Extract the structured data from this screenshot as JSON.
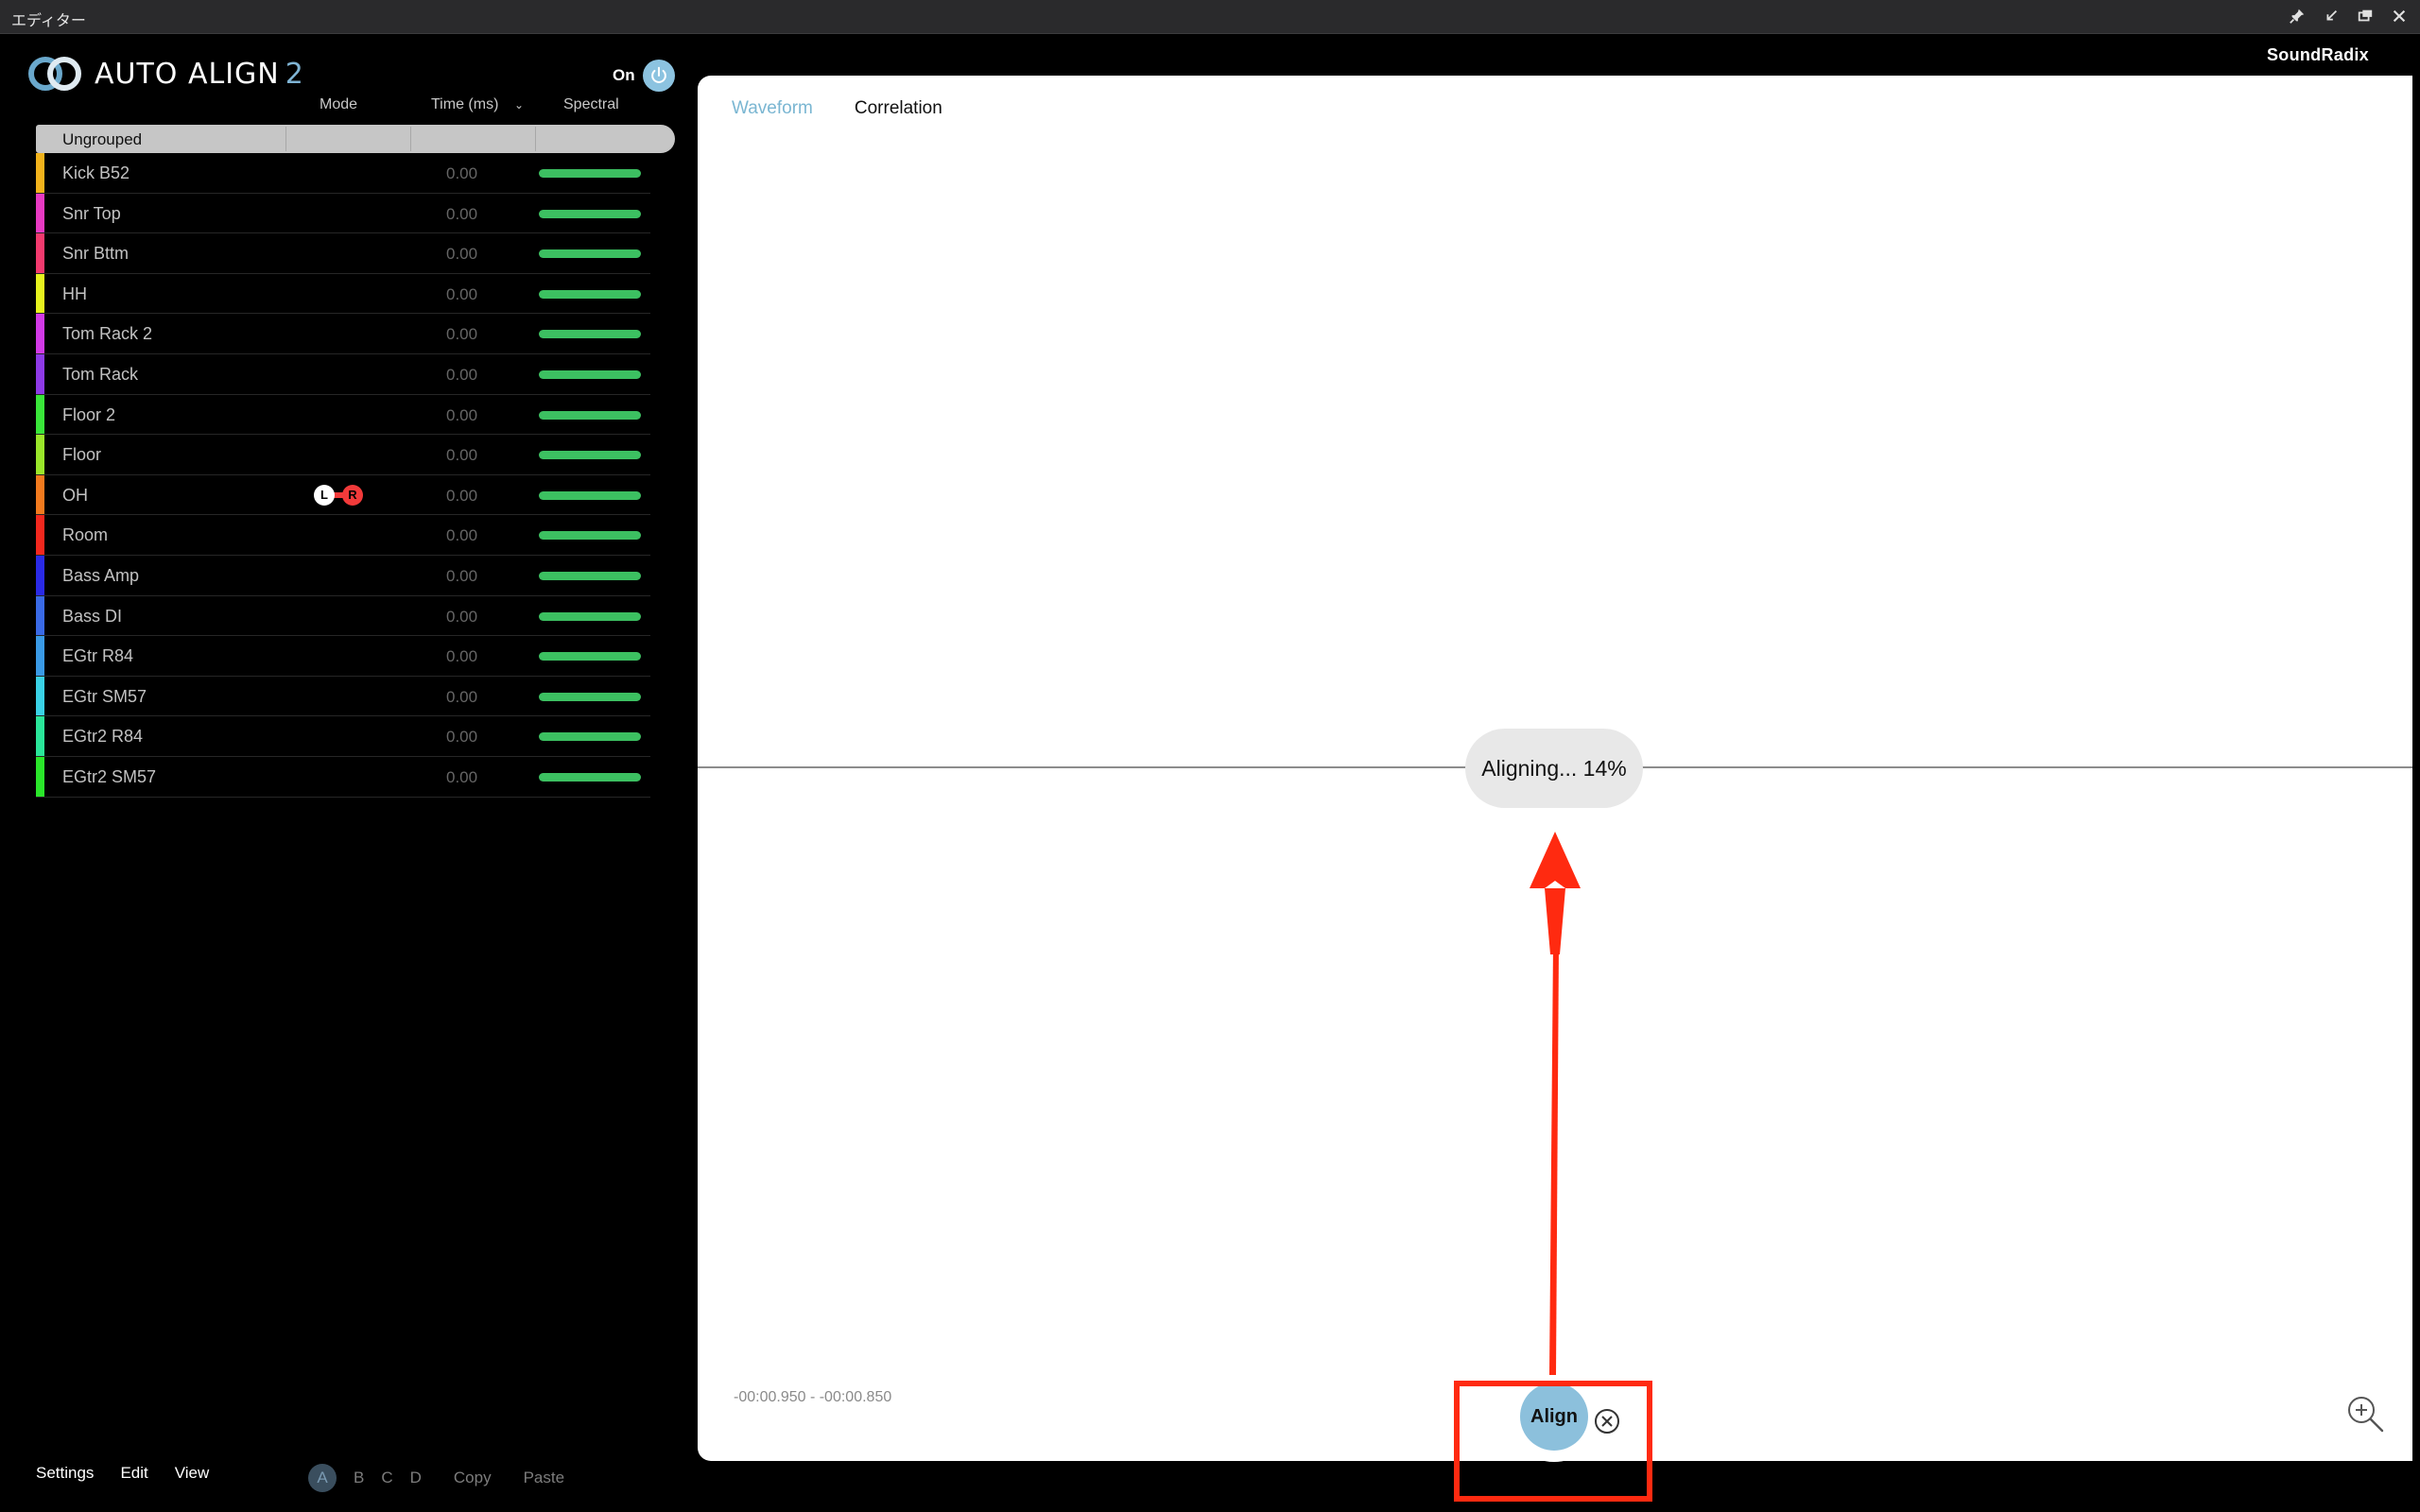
{
  "window": {
    "title": "エディター",
    "controls": [
      "pin-icon",
      "collapse-icon",
      "window-icon",
      "close-icon"
    ]
  },
  "plugin": {
    "logo_text": "AUTO ALIGN",
    "logo_number": "2",
    "power_label": "On",
    "brand": "SoundRadix"
  },
  "columns": {
    "mode": "Mode",
    "time": "Time (ms)",
    "spectral": "Spectral"
  },
  "group": {
    "name": "Ungrouped"
  },
  "tracks": [
    {
      "name": "Kick B52",
      "time": "0.00",
      "color": "#f2b31c"
    },
    {
      "name": "Snr Top",
      "time": "0.00",
      "color": "#e83ac2"
    },
    {
      "name": "Snr Bttm",
      "time": "0.00",
      "color": "#f23a6e"
    },
    {
      "name": "HH",
      "time": "0.00",
      "color": "#e6f21e"
    },
    {
      "name": "Tom Rack 2",
      "time": "0.00",
      "color": "#d23ae6"
    },
    {
      "name": "Tom Rack",
      "time": "0.00",
      "color": "#8e3ae6"
    },
    {
      "name": "Floor 2",
      "time": "0.00",
      "color": "#3ae63a"
    },
    {
      "name": "Floor",
      "time": "0.00",
      "color": "#9ae62a"
    },
    {
      "name": "OH",
      "time": "0.00",
      "color": "#f27a1e",
      "mode": {
        "left": "L",
        "right": "R"
      }
    },
    {
      "name": "Room",
      "time": "0.00",
      "color": "#f2281e"
    },
    {
      "name": "Bass Amp",
      "time": "0.00",
      "color": "#2a2ae6"
    },
    {
      "name": "Bass DI",
      "time": "0.00",
      "color": "#3a6ae6"
    },
    {
      "name": "EGtr R84",
      "time": "0.00",
      "color": "#3a9ae6"
    },
    {
      "name": "EGtr SM57",
      "time": "0.00",
      "color": "#3ad2e6"
    },
    {
      "name": "EGtr2 R84",
      "time": "0.00",
      "color": "#2ae69a"
    },
    {
      "name": "EGtr2 SM57",
      "time": "0.00",
      "color": "#2ae62a"
    }
  ],
  "footer": {
    "menu": [
      "Settings",
      "Edit",
      "View"
    ],
    "snapshots": [
      "A",
      "B",
      "C",
      "D"
    ],
    "copy": "Copy",
    "paste": "Paste"
  },
  "view": {
    "tabs": [
      "Waveform",
      "Correlation"
    ],
    "active_tab": "Waveform",
    "status": "Aligning... 14%",
    "progress_percent": 14,
    "time_range": "-00:00.950 - -00:00.850"
  },
  "align": {
    "label": "Align"
  },
  "colors": {
    "accent": "#8cc3e0",
    "spectral_bar": "#3cc061",
    "annotation": "#ff2a10"
  }
}
